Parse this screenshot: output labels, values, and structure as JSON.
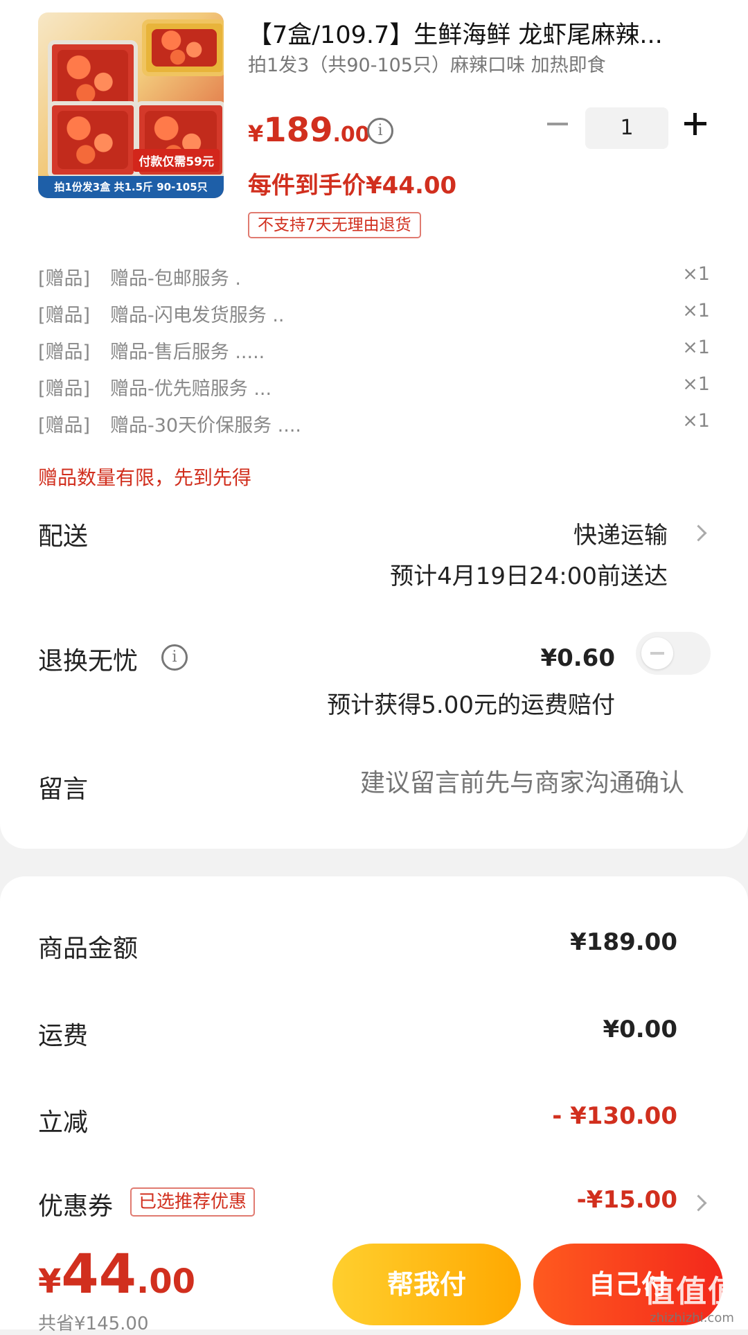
{
  "product": {
    "image_promo": "付款仅需59元",
    "image_strip": "拍1份发3盒 共1.5斤 90-105只",
    "title": "【7盒/109.7】生鲜海鲜 龙虾尾麻辣...",
    "subtitle": "拍1发3（共90-105只）麻辣口味 加热即食",
    "price_currency": "¥",
    "price_int": "189",
    "price_dec": ".00",
    "quantity": "1",
    "unit_price": "每件到手价¥44.00",
    "return_badge": "不支持7天无理由退货"
  },
  "gifts": [
    {
      "tag": "[赠品]",
      "name": "赠品-包邮服务 .",
      "qty": "×1"
    },
    {
      "tag": "[赠品]",
      "name": "赠品-闪电发货服务 ..",
      "qty": "×1"
    },
    {
      "tag": "[赠品]",
      "name": "赠品-售后服务 .....",
      "qty": "×1"
    },
    {
      "tag": "[赠品]",
      "name": "赠品-优先赔服务 ...",
      "qty": "×1"
    },
    {
      "tag": "[赠品]",
      "name": "赠品-30天价保服务 ....",
      "qty": "×1"
    }
  ],
  "gift_note": "赠品数量有限，先到先得",
  "delivery": {
    "label": "配送",
    "method": "快递运输",
    "eta": "预计4月19日24:00前送达"
  },
  "return_insurance": {
    "label": "退换无忧",
    "price": "¥0.60",
    "desc": "预计获得5.00元的运费赔付",
    "enabled": false
  },
  "message": {
    "label": "留言",
    "placeholder": "建议留言前先与商家沟通确认"
  },
  "summary": {
    "goods_label": "商品金额",
    "goods_value": "¥189.00",
    "shipping_label": "运费",
    "shipping_value": "¥0.00",
    "discount_label": "立减",
    "discount_value": "- ¥130.00",
    "coupon_label": "优惠券",
    "coupon_tag": "已选推荐优惠",
    "coupon_value": "-¥15.00"
  },
  "footer": {
    "total_currency": "¥",
    "total_int": "44",
    "total_dec": ".00",
    "saved": "共省¥145.00",
    "help_pay": "帮我付",
    "self_pay": "自己付",
    "watermark": "值值值",
    "watermark_url": "zhizhizhi.com"
  },
  "colors": {
    "accent_red": "#d12f1e",
    "help_button": "#ffb400",
    "self_button": "#f3281b"
  }
}
